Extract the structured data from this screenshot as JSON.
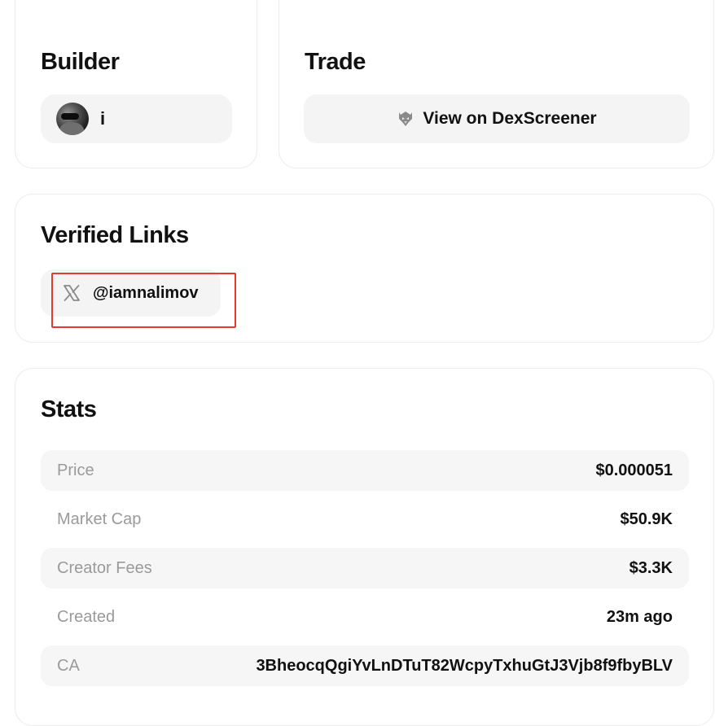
{
  "builder": {
    "title": "Builder",
    "name": "i"
  },
  "trade": {
    "title": "Trade",
    "button_label": "View on DexScreener",
    "icon": "dexscreener-icon"
  },
  "verified_links": {
    "title": "Verified Links",
    "links": [
      {
        "platform_icon": "x-logo-icon",
        "handle": "@iamnalimov"
      }
    ]
  },
  "stats": {
    "title": "Stats",
    "rows": [
      {
        "label": "Price",
        "value": "$0.000051"
      },
      {
        "label": "Market Cap",
        "value": "$50.9K"
      },
      {
        "label": "Creator Fees",
        "value": "$3.3K"
      },
      {
        "label": "Created",
        "value": "23m ago"
      },
      {
        "label": "CA",
        "value": "3BheocqQgiYvLnDTuT82WcpyTxhuGtJ3Vjb8f9fbyBLV"
      }
    ]
  },
  "colors": {
    "highlight": "#e23a2e",
    "chip_bg": "#f4f4f4",
    "muted_text": "#9a9a9a"
  }
}
